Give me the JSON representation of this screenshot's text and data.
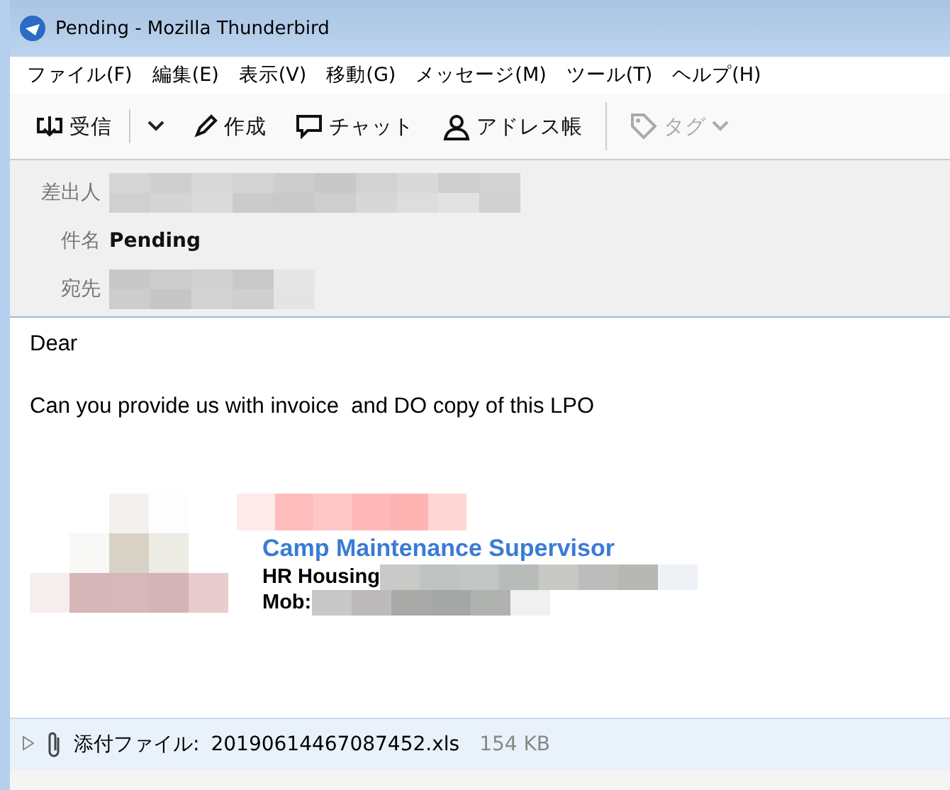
{
  "window": {
    "title": "Pending - Mozilla Thunderbird"
  },
  "menu": [
    "ファイル(F)",
    "編集(E)",
    "表示(V)",
    "移動(G)",
    "メッセージ(M)",
    "ツール(T)",
    "ヘルプ(H)"
  ],
  "toolbar": [
    {
      "kind": "receive",
      "label": "受信",
      "disabled": false
    },
    {
      "kind": "compose",
      "label": "作成",
      "disabled": false
    },
    {
      "kind": "chat",
      "label": "チャット",
      "disabled": false
    },
    {
      "kind": "address",
      "label": "アドレス帳",
      "disabled": false
    },
    {
      "kind": "tag",
      "label": "タグ",
      "disabled": true
    }
  ],
  "header": [
    {
      "label": "差出人",
      "kind": "redacted"
    },
    {
      "label": "件名",
      "kind": "text",
      "value": "Pending"
    },
    {
      "label": "宛先",
      "kind": "redacted"
    }
  ],
  "body": {
    "lines": [
      "Dear",
      "Can you provide us with invoice  and DO copy of this LPO"
    ],
    "signature": {
      "title": "Camp Maintenance Supervisor",
      "lines": [
        "HR Housing",
        "Mob:"
      ]
    }
  },
  "attachment": {
    "label": "添付ファイル:",
    "filename": "20190614467087452.xls",
    "size": "154 KB",
    "expanded": false
  }
}
